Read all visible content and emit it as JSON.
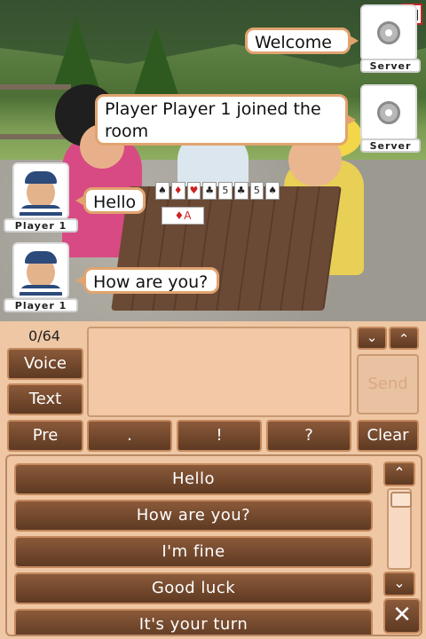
{
  "scene": {
    "chat_bubbles": [
      {
        "text": "Welcome"
      },
      {
        "text": "Player Player 1 joined the room"
      },
      {
        "text": "Hello"
      },
      {
        "text": "How are you?"
      }
    ],
    "senders": [
      {
        "name": "Server",
        "icon": "gear-icon"
      },
      {
        "name": "Server",
        "icon": "gear-icon"
      },
      {
        "name": "Player 1",
        "icon": "avatar-icon"
      },
      {
        "name": "Player 1",
        "icon": "avatar-icon"
      }
    ],
    "hand_cards": [
      "♠",
      "♦",
      "♥",
      "♣",
      "5",
      "♣",
      "5",
      "♠"
    ],
    "table_card": "♦A",
    "signal_icon": "signal-strength-icon"
  },
  "panel": {
    "char_counter": "0/64",
    "voice_label": "Voice",
    "text_label": "Text",
    "pre_label": "Pre",
    "period_label": ".",
    "exclaim_label": "!",
    "question_label": "?",
    "clear_label": "Clear",
    "send_label": "Send",
    "scroll_down_icon": "chevron-down-icon",
    "scroll_up_icon": "chevron-up-icon",
    "phrases": [
      "Hello",
      "How are you?",
      "I'm fine",
      "Good luck",
      "It's your turn"
    ],
    "close_icon": "close-icon"
  },
  "colors": {
    "accent_border": "#e1a36f",
    "button_dark": "#5e3a22",
    "panel_bg": "#efc7a4"
  }
}
